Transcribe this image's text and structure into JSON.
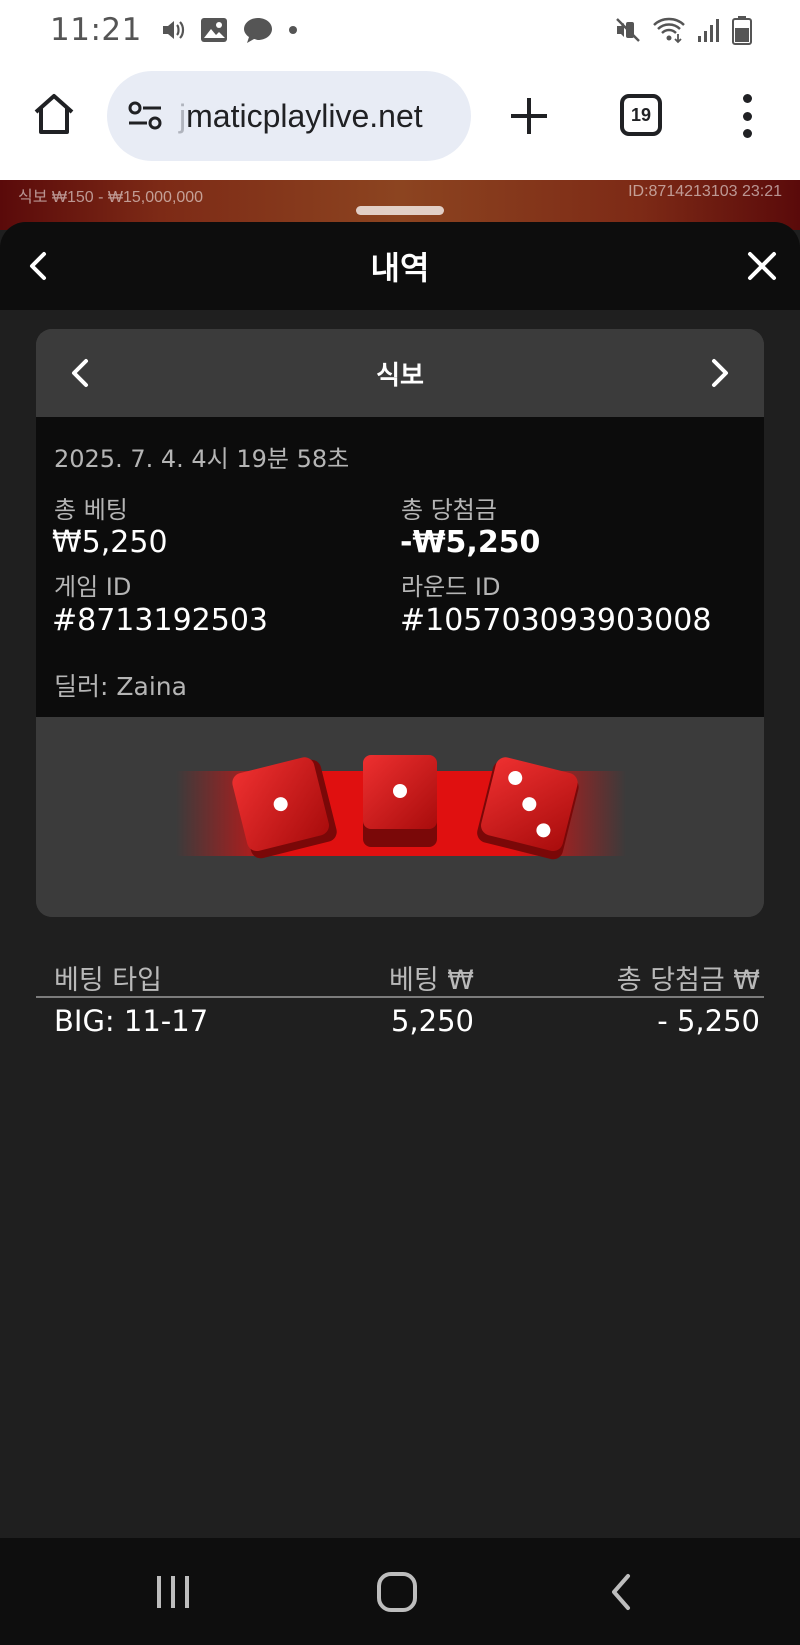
{
  "status_bar": {
    "time": "11:21",
    "left_icons": [
      "volume-icon",
      "image-icon",
      "messenger-icon",
      "notification-dot-icon"
    ],
    "right_icons": [
      "mute-icon",
      "wifi-icon",
      "signal-icon",
      "battery-icon"
    ]
  },
  "browser": {
    "url_faded": "j",
    "url": "maticplaylive.net",
    "tab_count": "19"
  },
  "game_strip": {
    "limits": "식보  ₩150 - ₩15,000,000",
    "id_time": "ID:8714213103  23:21"
  },
  "sheet": {
    "title": "내역"
  },
  "round": {
    "game": "식보",
    "datetime": "2025. 7. 4. 4시 19분 58초",
    "total_bet_label": "총 베팅",
    "total_bet_value": "₩5,250",
    "total_win_label": "총 당첨금",
    "total_win_value": "-₩5,250",
    "game_id_label": "게임 ID",
    "game_id_value": "#8713192503",
    "round_id_label": "라운드 ID",
    "round_id_value": "#105703093903008",
    "dealer": "딜러: Zaina",
    "dice": [
      1,
      1,
      3
    ],
    "colors": {
      "dice_red": "#d41414",
      "result_band": "#e01010",
      "info_bg": "#0c0c0c",
      "card_bg": "#3b3b3b"
    }
  },
  "bets_table": {
    "headers": {
      "type": "베팅 타입",
      "bet": "베팅 ₩",
      "win": "총 당첨금 ₩"
    },
    "rows": [
      {
        "type": "BIG: 11-17",
        "bet": "5,250",
        "win": "- 5,250"
      }
    ]
  }
}
